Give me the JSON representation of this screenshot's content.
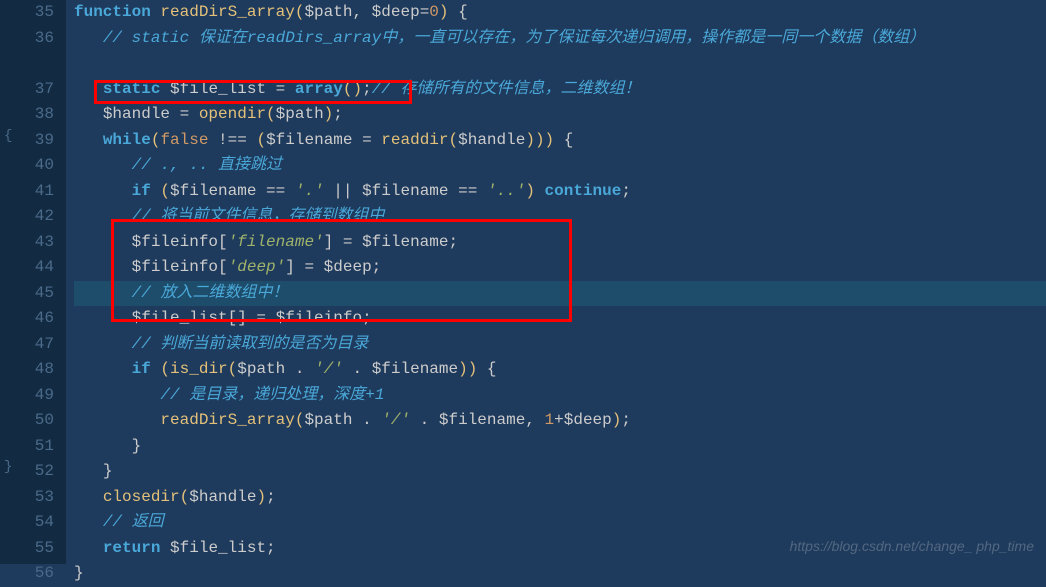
{
  "lines": [
    {
      "num": "35",
      "bracket": "",
      "tokens": [
        [
          "kw",
          "function "
        ],
        [
          "fn-name",
          "readDirS_array"
        ],
        [
          "paren",
          "("
        ],
        [
          "var",
          "$path"
        ],
        [
          "op",
          ", "
        ],
        [
          "var",
          "$deep"
        ],
        [
          "op",
          "="
        ],
        [
          "num",
          "0"
        ],
        [
          "paren",
          ") "
        ],
        [
          "brace",
          "{"
        ]
      ]
    },
    {
      "num": "36",
      "bracket": "",
      "tokens": [
        [
          "op",
          "   "
        ],
        [
          "comment",
          "// static 保证在readDirs_array中，一直可以存在，为了保证每次递归调用，操作都是一同一个数据（数组）"
        ]
      ]
    },
    {
      "num": "",
      "bracket": "",
      "tokens": []
    },
    {
      "num": "37",
      "bracket": "",
      "tokens": [
        [
          "op",
          "   "
        ],
        [
          "kw",
          "static "
        ],
        [
          "var",
          "$file_list "
        ],
        [
          "op",
          "= "
        ],
        [
          "builtin",
          "array"
        ],
        [
          "paren",
          "()"
        ],
        [
          "op",
          ";"
        ],
        [
          "comment",
          "// 存储所有的文件信息，二维数组！"
        ]
      ]
    },
    {
      "num": "38",
      "bracket": "",
      "tokens": [
        [
          "op",
          "   "
        ],
        [
          "var",
          "$handle "
        ],
        [
          "op",
          "= "
        ],
        [
          "fn-name",
          "opendir"
        ],
        [
          "paren",
          "("
        ],
        [
          "var",
          "$path"
        ],
        [
          "paren",
          ")"
        ],
        [
          "op",
          ";"
        ]
      ]
    },
    {
      "num": "39",
      "bracket": "{",
      "tokens": [
        [
          "op",
          "   "
        ],
        [
          "kw",
          "while"
        ],
        [
          "paren",
          "("
        ],
        [
          "bool",
          "false"
        ],
        [
          "op",
          " !== "
        ],
        [
          "paren",
          "("
        ],
        [
          "var",
          "$filename "
        ],
        [
          "op",
          "= "
        ],
        [
          "fn-name",
          "readdir"
        ],
        [
          "paren",
          "("
        ],
        [
          "var",
          "$handle"
        ],
        [
          "paren",
          "))) "
        ],
        [
          "brace",
          "{"
        ]
      ]
    },
    {
      "num": "40",
      "bracket": "",
      "tokens": [
        [
          "op",
          "      "
        ],
        [
          "comment",
          "// ., .. 直接跳过"
        ]
      ]
    },
    {
      "num": "41",
      "bracket": "",
      "tokens": [
        [
          "op",
          "      "
        ],
        [
          "kw",
          "if "
        ],
        [
          "paren",
          "("
        ],
        [
          "var",
          "$filename "
        ],
        [
          "op",
          "== "
        ],
        [
          "str",
          "'.'"
        ],
        [
          "op",
          " || "
        ],
        [
          "var",
          "$filename "
        ],
        [
          "op",
          "== "
        ],
        [
          "str",
          "'..'"
        ],
        [
          "paren",
          ") "
        ],
        [
          "kw",
          "continue"
        ],
        [
          "op",
          ";"
        ]
      ]
    },
    {
      "num": "42",
      "bracket": "",
      "tokens": [
        [
          "op",
          "      "
        ],
        [
          "comment",
          "// 将当前文件信息，存储到数组中"
        ]
      ]
    },
    {
      "num": "43",
      "bracket": "",
      "tokens": [
        [
          "op",
          "      "
        ],
        [
          "var",
          "$fileinfo"
        ],
        [
          "op",
          "["
        ],
        [
          "str",
          "'filename'"
        ],
        [
          "op",
          "] = "
        ],
        [
          "var",
          "$filename"
        ],
        [
          "op",
          ";"
        ]
      ]
    },
    {
      "num": "44",
      "bracket": "",
      "tokens": [
        [
          "op",
          "      "
        ],
        [
          "var",
          "$fileinfo"
        ],
        [
          "op",
          "["
        ],
        [
          "str",
          "'deep'"
        ],
        [
          "op",
          "] = "
        ],
        [
          "var",
          "$deep"
        ],
        [
          "op",
          ";"
        ]
      ]
    },
    {
      "num": "45",
      "bracket": "",
      "highlighted": true,
      "tokens": [
        [
          "op",
          "      "
        ],
        [
          "comment",
          "// 放入二维数组中！"
        ]
      ]
    },
    {
      "num": "46",
      "bracket": "",
      "tokens": [
        [
          "op",
          "      "
        ],
        [
          "var",
          "$file_list"
        ],
        [
          "op",
          "[] = "
        ],
        [
          "var",
          "$fileinfo"
        ],
        [
          "op",
          ";"
        ]
      ]
    },
    {
      "num": "47",
      "bracket": "",
      "tokens": [
        [
          "op",
          "      "
        ],
        [
          "comment",
          "// 判断当前读取到的是否为目录"
        ]
      ]
    },
    {
      "num": "48",
      "bracket": "",
      "tokens": [
        [
          "op",
          "      "
        ],
        [
          "kw",
          "if "
        ],
        [
          "paren",
          "("
        ],
        [
          "fn-name",
          "is_dir"
        ],
        [
          "paren",
          "("
        ],
        [
          "var",
          "$path "
        ],
        [
          "op",
          ". "
        ],
        [
          "str",
          "'/'"
        ],
        [
          "op",
          " . "
        ],
        [
          "var",
          "$filename"
        ],
        [
          "paren",
          ")) "
        ],
        [
          "brace",
          "{"
        ]
      ]
    },
    {
      "num": "49",
      "bracket": "",
      "tokens": [
        [
          "op",
          "         "
        ],
        [
          "comment",
          "// 是目录，递归处理，深度+1"
        ]
      ]
    },
    {
      "num": "50",
      "bracket": "",
      "tokens": [
        [
          "op",
          "         "
        ],
        [
          "fn-name",
          "readDirS_array"
        ],
        [
          "paren",
          "("
        ],
        [
          "var",
          "$path "
        ],
        [
          "op",
          ". "
        ],
        [
          "str",
          "'/'"
        ],
        [
          "op",
          " . "
        ],
        [
          "var",
          "$filename"
        ],
        [
          "op",
          ", "
        ],
        [
          "num",
          "1"
        ],
        [
          "op",
          "+"
        ],
        [
          "var",
          "$deep"
        ],
        [
          "paren",
          ")"
        ],
        [
          "op",
          ";"
        ]
      ]
    },
    {
      "num": "51",
      "bracket": "",
      "tokens": [
        [
          "op",
          "      "
        ],
        [
          "brace",
          "}"
        ]
      ]
    },
    {
      "num": "52",
      "bracket": "}",
      "tokens": [
        [
          "op",
          "   "
        ],
        [
          "brace",
          "}"
        ]
      ]
    },
    {
      "num": "53",
      "bracket": "",
      "tokens": [
        [
          "op",
          "   "
        ],
        [
          "fn-name",
          "closedir"
        ],
        [
          "paren",
          "("
        ],
        [
          "var",
          "$handle"
        ],
        [
          "paren",
          ")"
        ],
        [
          "op",
          ";"
        ]
      ]
    },
    {
      "num": "54",
      "bracket": "",
      "tokens": [
        [
          "op",
          "   "
        ],
        [
          "comment",
          "// 返回"
        ]
      ]
    },
    {
      "num": "55",
      "bracket": "",
      "tokens": [
        [
          "op",
          "   "
        ],
        [
          "kw",
          "return "
        ],
        [
          "var",
          "$file_list"
        ],
        [
          "op",
          ";"
        ]
      ]
    },
    {
      "num": "56",
      "bracket": "",
      "tokens": [
        [
          "brace",
          "}"
        ]
      ]
    }
  ],
  "watermark": "https://blog.csdn.net/change_ php_time"
}
